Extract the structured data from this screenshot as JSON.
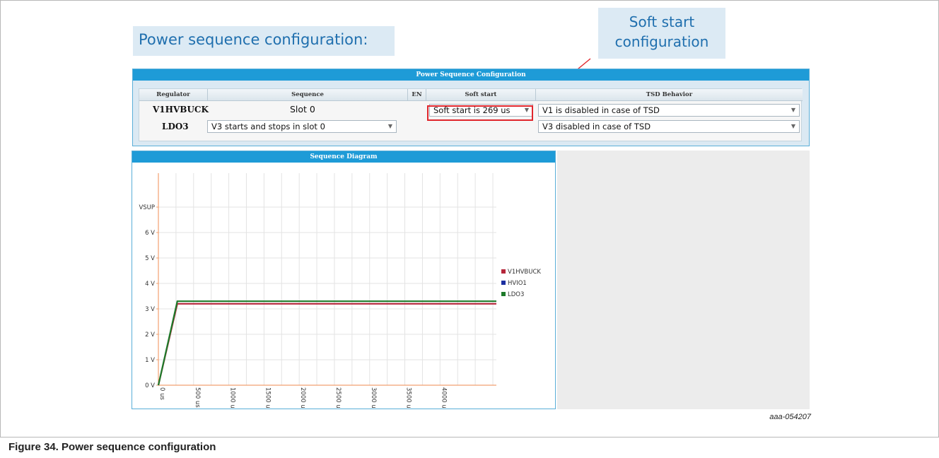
{
  "heading": "Power sequence configuration:",
  "callout": {
    "line1": "Soft start",
    "line2": "configuration"
  },
  "config_panel": {
    "title": "Power Sequence Configuration",
    "columns": [
      "Regulator",
      "Sequence",
      "EN",
      "Soft start",
      "TSD Behavior"
    ],
    "rows": [
      {
        "regulator": "V1HVBUCK",
        "sequence": "Slot 0",
        "soft_start": "Soft start is 269 us",
        "tsd": "V1 is disabled in case of TSD"
      },
      {
        "regulator": "LDO3",
        "sequence": "V3 starts and stops in slot 0",
        "tsd": "V3 disabled in case of TSD"
      }
    ]
  },
  "diagram_panel": {
    "title": "Sequence Diagram"
  },
  "chart_data": {
    "type": "line",
    "title": "",
    "xlabel": "",
    "ylabel": "",
    "x_ticks": [
      "0 us",
      "500 us",
      "1000 us",
      "1500 us",
      "2000 us",
      "2500 us",
      "3000 us",
      "3500 us",
      "4000 us"
    ],
    "y_ticks": [
      "0 V",
      "1 V",
      "2 V",
      "3 V",
      "4 V",
      "5 V",
      "6 V",
      "VSUP"
    ],
    "xlim": [
      0,
      4800
    ],
    "ylim": [
      0,
      7
    ],
    "legend_position": "right",
    "series": [
      {
        "name": "V1HVBUCK",
        "color": "#b5263a",
        "x": [
          0,
          269,
          4800
        ],
        "y": [
          0,
          3.2,
          3.2
        ]
      },
      {
        "name": "HVIO1",
        "color": "#1c2fa0",
        "x": [],
        "y": []
      },
      {
        "name": "LDO3",
        "color": "#1d7a2a",
        "x": [
          0,
          269,
          4800
        ],
        "y": [
          0,
          3.3,
          3.3
        ]
      }
    ]
  },
  "figure_tag": "aaa-054207",
  "caption": "Figure 34.  Power sequence configuration"
}
